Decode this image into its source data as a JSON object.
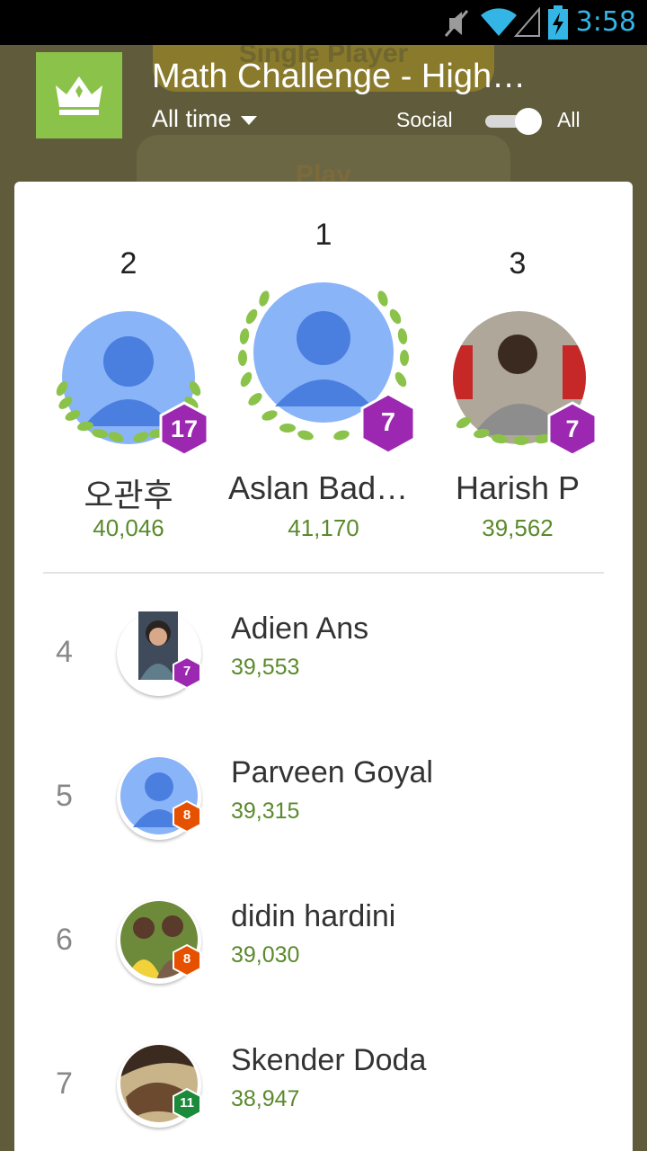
{
  "status_bar": {
    "time": "3:58",
    "icons": [
      "mute-icon",
      "wifi-icon",
      "signal-icon",
      "battery-charging-icon"
    ]
  },
  "background": {
    "mode_label": "Single Player",
    "play_label": "Play"
  },
  "header": {
    "title": "Math Challenge - High…",
    "time_filter": "All time",
    "toggle_left_label": "Social",
    "toggle_right_label": "All",
    "toggle_state": "All",
    "app_icon": "crown-icon"
  },
  "podium": [
    {
      "rank": "2",
      "name": "오관후",
      "score": "40,046",
      "level": "17",
      "avatar": "default-avatar"
    },
    {
      "rank": "1",
      "name": "Aslan Badu…",
      "score": "41,170",
      "level": "7",
      "avatar": "default-avatar"
    },
    {
      "rank": "3",
      "name": "Harish P",
      "score": "39,562",
      "level": "7",
      "avatar": "photo-avatar"
    }
  ],
  "list": [
    {
      "rank": "4",
      "name": "Adien Ans",
      "score": "39,553",
      "level": "7",
      "badge_color": "#9c27b0",
      "avatar": "photo-avatar"
    },
    {
      "rank": "5",
      "name": "Parveen Goyal",
      "score": "39,315",
      "level": "8",
      "badge_color": "#e65100",
      "avatar": "default-avatar"
    },
    {
      "rank": "6",
      "name": "didin hardini",
      "score": "39,030",
      "level": "8",
      "badge_color": "#e65100",
      "avatar": "photo-avatar"
    },
    {
      "rank": "7",
      "name": "Skender Doda",
      "score": "38,947",
      "level": "11",
      "badge_color": "#1b8a3a",
      "avatar": "photo-avatar"
    }
  ],
  "colors": {
    "accent_green": "#8bc34a",
    "score_green": "#5a8a2c",
    "level_purple": "#9c27b0",
    "default_avatar_bg": "#8ab4f8",
    "default_avatar_fg": "#4a7fe0",
    "status_blue": "#33b5e5"
  }
}
